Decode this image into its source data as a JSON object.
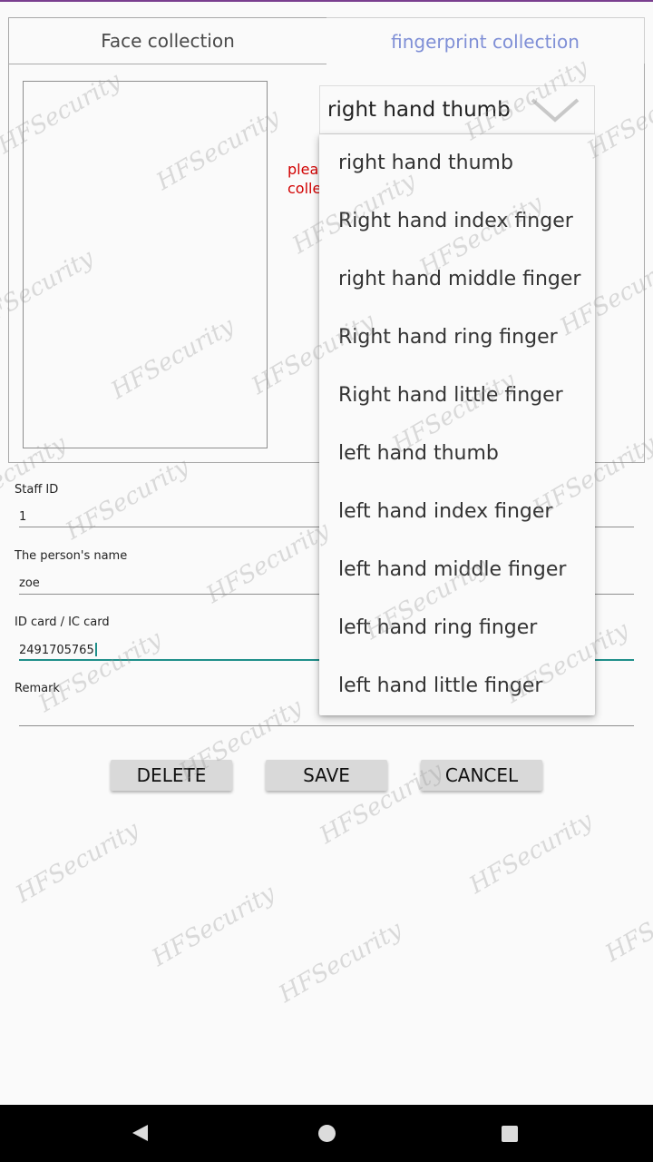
{
  "tabs": {
    "face": "Face collection",
    "fingerprint": "fingerprint collection"
  },
  "fingerprint_panel": {
    "hint_line1": "plea",
    "hint_line2": "colle"
  },
  "finger_select": {
    "selected": "right hand thumb",
    "options": [
      "right hand thumb",
      "Right hand index finger",
      "right hand middle finger",
      "Right hand ring finger",
      "Right hand little finger",
      "left hand thumb",
      "left hand index finger",
      "left hand middle finger",
      "left hand ring finger",
      "left hand little finger"
    ]
  },
  "form": {
    "staff_id": {
      "label": "Staff ID",
      "value": "1"
    },
    "name": {
      "label": "The person's name",
      "value": "zoe"
    },
    "id_card": {
      "label": "ID card / IC card",
      "value": "2491705765"
    },
    "remark": {
      "label": "Remark",
      "value": ""
    }
  },
  "buttons": {
    "delete": "DELETE",
    "save": "SAVE",
    "cancel": "CANCEL"
  },
  "watermark": "HFSecurity",
  "colors": {
    "accent_tab": "#7f8fd6",
    "hint_red": "#d10000",
    "focus_teal": "#1f8f8a"
  },
  "nav": {
    "back": "back-icon",
    "home": "home-icon",
    "recents": "recents-icon"
  }
}
